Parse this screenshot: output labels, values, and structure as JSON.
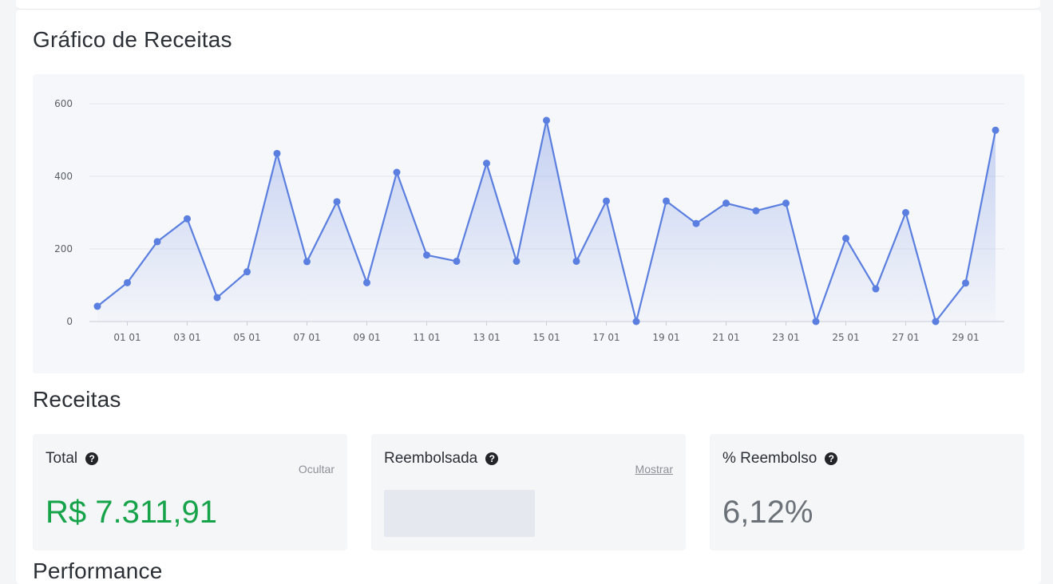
{
  "chart_section": {
    "title": "Gráfico de Receitas"
  },
  "chart_data": {
    "type": "area",
    "title": "",
    "xlabel": "",
    "ylabel": "",
    "ylim": [
      0,
      600
    ],
    "yticks": [
      "0",
      "200",
      "400",
      "600"
    ],
    "xticks": [
      "01 01",
      "03 01",
      "05 01",
      "07 01",
      "09 01",
      "11 01",
      "13 01",
      "15 01",
      "17 01",
      "19 01",
      "21 01",
      "23 01",
      "25 01",
      "27 01",
      "29 01"
    ],
    "grid": true,
    "line_color": "#5b7fe0",
    "series": [
      {
        "values": [
          42,
          107,
          220,
          283,
          66,
          137,
          463,
          165,
          330,
          107,
          411,
          183,
          166,
          436,
          166,
          554,
          166,
          332,
          0,
          332,
          270,
          326,
          305,
          326,
          0,
          229,
          90,
          300,
          0,
          106,
          527
        ]
      }
    ]
  },
  "revenue_section": {
    "title": "Receitas"
  },
  "cards": {
    "total": {
      "label": "Total",
      "action": "Ocultar",
      "value": "R$ 7.311,91"
    },
    "refunded": {
      "label": "Reembolsada",
      "action": "Mostrar"
    },
    "refund_percent": {
      "label": "% Reembolso",
      "value": "6,12%"
    }
  },
  "next_section": {
    "title": "Performance"
  },
  "icons": {
    "help": "question-circle-icon"
  },
  "colors": {
    "positive": "#16a34a",
    "accent": "#5b7fe0"
  }
}
